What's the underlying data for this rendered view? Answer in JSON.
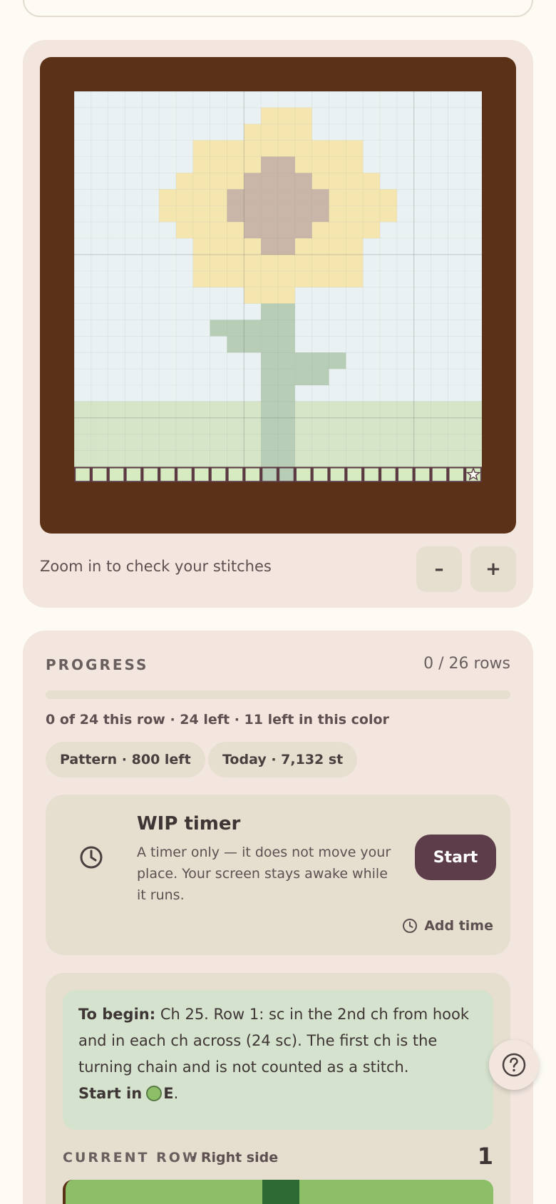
{
  "viewer": {
    "zoom_hint": "Zoom in to check your stitches",
    "zoom_out_label": "–",
    "zoom_in_label": "+",
    "colors": {
      "frame": "#5b3217",
      "sky": "#e9f1f2",
      "ground": "#d6e5c8",
      "petal": "#f5e6b0",
      "center": "#c9b6a8",
      "stem": "#b7cdb6",
      "row_done_cell": "#d6ecc0"
    },
    "pattern_size": [
      24,
      24
    ],
    "row_marker_cells": 24,
    "row_marker_end_icon": "star-icon"
  },
  "progress": {
    "label": "PROGRESS",
    "rows_text": "0 / 26 rows",
    "fraction": 0,
    "row_stats": "0 of 24 this row · 24 left · 11 left in this color",
    "chip_pattern": "Pattern · 800 left",
    "chip_today": "Today · 7,132 st"
  },
  "timer": {
    "title": "WIP timer",
    "description": "A timer only — it does not move your place. Your screen stays awake while it runs.",
    "start_label": "Start",
    "add_time_label": "Add time"
  },
  "instructions": {
    "begin_lead": "To begin:",
    "begin_text": " Ch 25. Row 1: sc in the 2nd ch from hook and in each ch across (24 sc). The first ch is the turning chain and is not counted as a stitch.",
    "start_in_prefix": "Start in",
    "start_in_color_code": "E",
    "start_in_suffix": ".",
    "start_color": "#8cbf68",
    "current_row_label": "CURRENT ROW",
    "current_row_side": "· Right side",
    "current_row_number": "1"
  }
}
